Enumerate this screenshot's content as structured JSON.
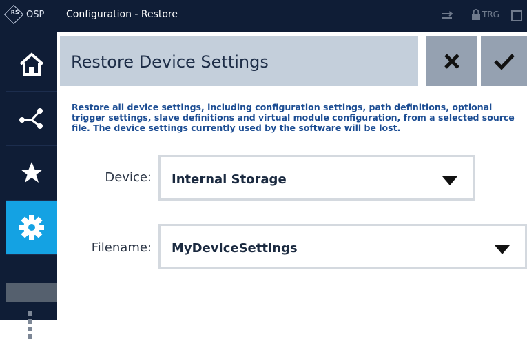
{
  "titlebar": {
    "logo_text": "OSP",
    "logo_mark": "RS",
    "title": "Configuration - Restore",
    "trig_label": "TRG"
  },
  "sidebar": {
    "items": [
      {
        "name": "home",
        "icon": "home-icon",
        "active": false
      },
      {
        "name": "paths",
        "icon": "path-icon",
        "active": false
      },
      {
        "name": "favorites",
        "icon": "star-icon",
        "active": false
      },
      {
        "name": "settings",
        "icon": "gear-icon",
        "active": true
      },
      {
        "name": "more",
        "icon": "more-icon",
        "active": false
      }
    ]
  },
  "dialog": {
    "title": "Restore Device Settings",
    "description": "Restore all device settings, including configuration settings, path definitions, optional trigger settings, slave definitions and virtual module configuration, from a selected source file. The device settings currently used by the software will be lost.",
    "fields": {
      "device_label": "Device:",
      "device_value": "Internal Storage",
      "filename_label": "Filename:",
      "filename_value": "MyDeviceSettings"
    }
  },
  "colors": {
    "titlebar": "#0f1d36",
    "active_nav": "#14a2e3",
    "header": "#c4cfdb",
    "header_button": "#95a1b1",
    "description_text": "#1c4d93"
  }
}
